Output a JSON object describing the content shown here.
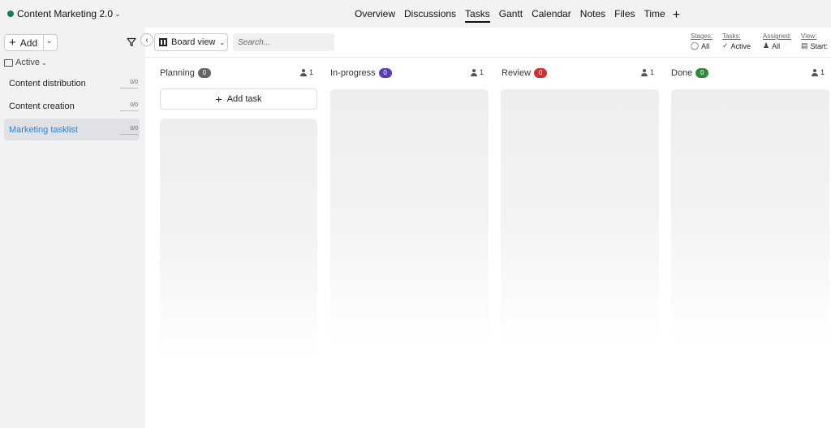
{
  "project": {
    "name": "Content Marketing 2.0",
    "dot_color": "#1a7a5e"
  },
  "nav": {
    "tabs": [
      {
        "label": "Overview"
      },
      {
        "label": "Discussions"
      },
      {
        "label": "Tasks",
        "active": true
      },
      {
        "label": "Gantt"
      },
      {
        "label": "Calendar"
      },
      {
        "label": "Notes"
      },
      {
        "label": "Files"
      },
      {
        "label": "Time"
      }
    ],
    "plus_label": "+"
  },
  "sidebar": {
    "add_label": "Add",
    "filter_label": "Active",
    "items": [
      {
        "label": "Content distribution",
        "count": "0/0"
      },
      {
        "label": "Content creation",
        "count": "0/0"
      },
      {
        "label": "Marketing tasklist",
        "count": "0/0",
        "selected": true
      }
    ]
  },
  "toolbar": {
    "view_label": "Board view",
    "search_placeholder": "Search...",
    "options": [
      {
        "key": "Stages:",
        "value": "All",
        "icon": "check-circle-icon"
      },
      {
        "key": "Tasks:",
        "value": "Active",
        "icon": "check-icon"
      },
      {
        "key": "Assigned:",
        "value": "All",
        "icon": "people-icon"
      },
      {
        "key": "View:",
        "value": "Start:",
        "icon": "calendar-icon"
      }
    ]
  },
  "board": {
    "add_task_label": "Add task",
    "columns": [
      {
        "name": "Planning",
        "count": "0",
        "color": "#666666",
        "assignees": "1"
      },
      {
        "name": "In-progress",
        "count": "0",
        "color": "#5b3db5",
        "assignees": "1"
      },
      {
        "name": "Review",
        "count": "0",
        "color": "#d32f2f",
        "assignees": "1"
      },
      {
        "name": "Done",
        "count": "0",
        "color": "#2e8b3a",
        "assignees": "1"
      }
    ]
  }
}
